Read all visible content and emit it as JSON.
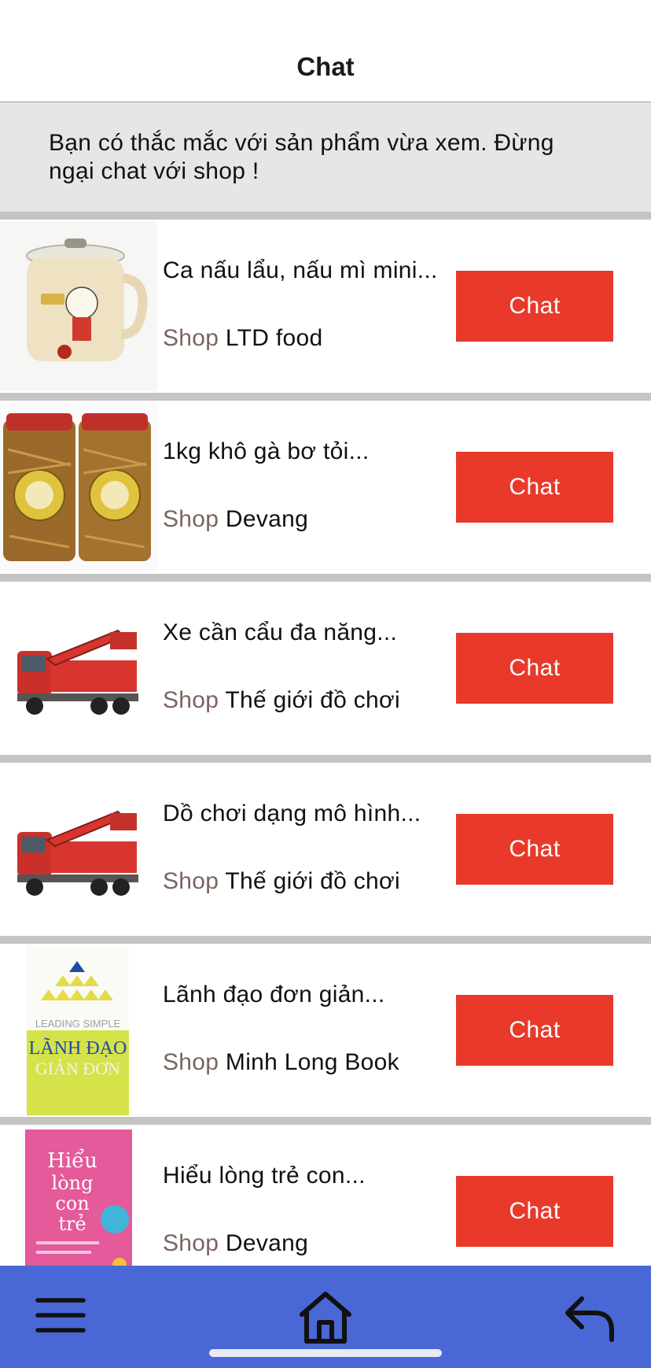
{
  "header": {
    "title": "Chat"
  },
  "notice": {
    "text": "Bạn có thắc mắc với sản phẩm vừa xem. Đừng ngại chat với shop !"
  },
  "products": [
    {
      "name": "Ca nấu lẩu, nấu mì mini...",
      "shop_label": "Shop",
      "shop_name": "LTD food",
      "button_label": "Chat",
      "image": "electric-pot"
    },
    {
      "name": "1kg khô gà bơ tỏi...",
      "shop_label": "Shop",
      "shop_name": "Devang",
      "button_label": "Chat",
      "image": "dried-chicken-jars"
    },
    {
      "name": "Xe cần cẩu đa năng...",
      "shop_label": "Shop",
      "shop_name": "Thế giới đồ chơi",
      "button_label": "Chat",
      "image": "fire-truck-toy"
    },
    {
      "name": "Dồ chơi dạng mô hình...",
      "shop_label": "Shop",
      "shop_name": "Thế giới đồ chơi",
      "button_label": "Chat",
      "image": "fire-truck-toy"
    },
    {
      "name": "Lãnh đạo đơn giản...",
      "shop_label": "Shop",
      "shop_name": "Minh Long Book",
      "button_label": "Chat",
      "image": "book-lanh-dao-don-gian",
      "image_text": [
        "LEADING SIMPLE",
        "LÃNH ĐẠO",
        "GIẢN ĐƠN"
      ]
    },
    {
      "name": "Hiểu lòng trẻ con...",
      "shop_label": "Shop",
      "shop_name": "Devang",
      "button_label": "Chat",
      "image": "book-hieu-long-con-tre",
      "image_text": [
        "Hiểu",
        "lòng",
        "con",
        "trẻ"
      ]
    }
  ],
  "bottom_nav": {
    "icons": [
      "menu-icon",
      "home-icon",
      "back-icon"
    ]
  },
  "colors": {
    "accent": "#e8392a",
    "nav": "#4a67d6",
    "notice_bg": "#e6e6e6",
    "separator": "#c4c4c4",
    "shop_label": "#7a6460"
  }
}
